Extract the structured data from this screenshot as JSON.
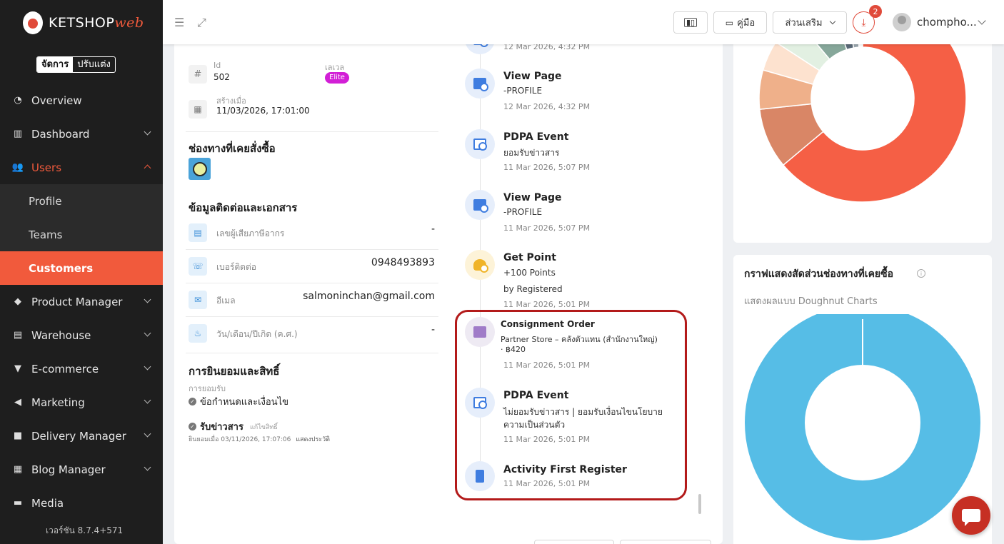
{
  "app": {
    "logo_main": "KETSHOP",
    "logo_accent": "web",
    "mode_manage": "จัดการ",
    "mode_customize": "ปรับแต่ง",
    "version": "เวอร์ชัน 8.7.4+571"
  },
  "sidebar": {
    "items": [
      {
        "label": "Overview",
        "icon": "pie-chart-icon"
      },
      {
        "label": "Dashboard",
        "icon": "bar-chart-icon"
      },
      {
        "label": "Users",
        "icon": "users-icon"
      },
      {
        "label": "Profile"
      },
      {
        "label": "Teams"
      },
      {
        "label": "Customers"
      },
      {
        "label": "Product Manager",
        "icon": "tag-icon"
      },
      {
        "label": "Warehouse",
        "icon": "warehouse-icon"
      },
      {
        "label": "E-commerce",
        "icon": "cart-icon"
      },
      {
        "label": "Marketing",
        "icon": "megaphone-icon"
      },
      {
        "label": "Delivery Manager",
        "icon": "truck-icon"
      },
      {
        "label": "Blog Manager",
        "icon": "blog-icon"
      },
      {
        "label": "Media",
        "icon": "folder-icon"
      }
    ]
  },
  "topbar": {
    "manual_label": "คู่มือ",
    "addons_label": "ส่วนเสริม",
    "download_badge": "2",
    "username": "chompho..."
  },
  "profile": {
    "id_label": "Id",
    "id_value": "502",
    "level_label": "เลเวล",
    "level_value": "Elite",
    "created_label": "สร้างเมื่อ",
    "created_value": "11/03/2026, 17:01:00",
    "channels_title": "ช่องทางที่เคยสั่งซื้อ",
    "contact_title": "ข้อมูลติดต่อและเอกสาร",
    "contacts": [
      {
        "label": "เลขผู้เสียภาษีอากร",
        "value": "-"
      },
      {
        "label": "เบอร์ติดต่อ",
        "value": "0948493893"
      },
      {
        "label": "อีเมล",
        "value": "salmoninchan@gmail.com"
      },
      {
        "label": "วัน/เดือน/ปีเกิด (ค.ศ.)",
        "value": "-"
      }
    ],
    "consent_title": "การยินยอมและสิทธิ์",
    "consent_sub": "การยอมรับ",
    "consent_terms": "ข้อกำหนดและเงื่อนไข",
    "consent_news": "รับข่าวสาร",
    "consent_edit": "แก้ไขสิทธิ์",
    "consent_date": "ยินยอมเมื่อ 03/11/2026, 17:07:06",
    "consent_history": "แสดงประวัติ"
  },
  "timeline": [
    {
      "title": "",
      "lines": [],
      "time": "12 Mar 2026, 4:32 PM",
      "icon": "page-icon"
    },
    {
      "title": "View Page",
      "lines": [
        "-PROFILE"
      ],
      "time": "12 Mar 2026, 4:32 PM",
      "icon": "page-icon"
    },
    {
      "title": "PDPA Event",
      "lines": [
        "ยอมรับข่าวสาร"
      ],
      "time": "11 Mar 2026, 5:07 PM",
      "icon": "document-icon"
    },
    {
      "title": "View Page",
      "lines": [
        "-PROFILE"
      ],
      "time": "11 Mar 2026, 5:07 PM",
      "icon": "page-icon"
    },
    {
      "title": "Get Point",
      "lines": [
        "+100 Points",
        "by Registered"
      ],
      "time": "11 Mar 2026, 5:01 PM",
      "icon": "point-icon"
    },
    {
      "title": "Consignment Order",
      "lines": [
        "Partner Store – คลังตัวแทน (สำนักงานใหญ่)",
        "· ฿420"
      ],
      "time": "11 Mar 2026, 5:01 PM",
      "icon": "consignment-icon"
    },
    {
      "title": "PDPA Event",
      "lines": [
        "ไม่ยอมรับข่าวสาร  |  ยอมรับเงื่อนไขนโยบาย",
        "ความเป็นส่วนตัว"
      ],
      "time": "11 Mar 2026, 5:01 PM",
      "icon": "document-icon"
    },
    {
      "title": "Activity First Register",
      "lines": [],
      "time": "11 Mar 2026, 5:01 PM",
      "icon": "register-icon"
    }
  ],
  "right": {
    "channel_chart_title": "กราฟแสดงสัดส่วนช่องทางที่เคยซื้อ",
    "channel_chart_sub": "แสดงผลแบบ Doughnut Charts"
  },
  "colors": {
    "accent": "#f15a3c",
    "highlight_border": "#b31a1a",
    "donut_blue": "#56bde6"
  }
}
